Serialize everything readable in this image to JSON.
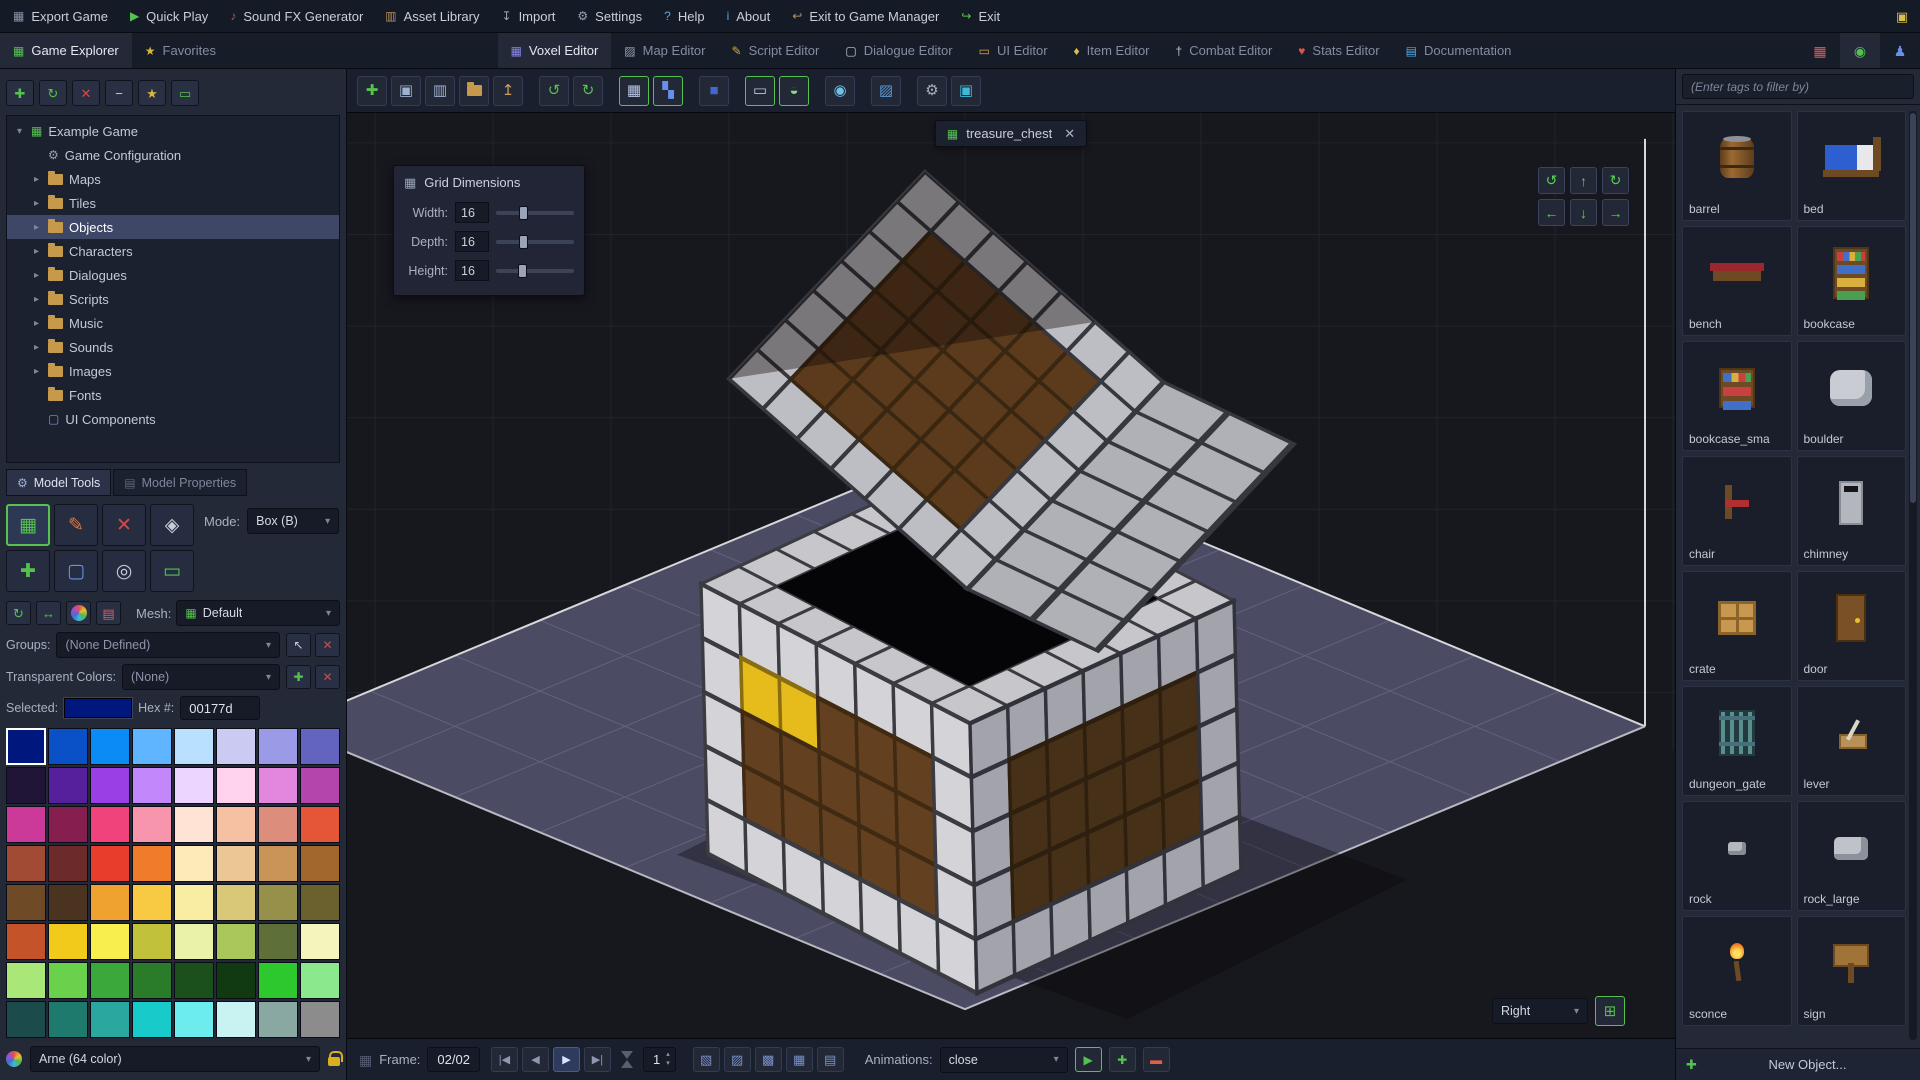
{
  "menu_bar": {
    "items": [
      {
        "name": "export-game",
        "label": "Export Game",
        "glyph": "▦",
        "color": "#8a92a8"
      },
      {
        "name": "quick-play",
        "label": "Quick Play",
        "glyph": "▶",
        "color": "#55c24f"
      },
      {
        "name": "sound-fx-generator",
        "label": "Sound FX Generator",
        "glyph": "♪",
        "color": "#c25050"
      },
      {
        "name": "asset-library",
        "label": "Asset Library",
        "glyph": "▥",
        "color": "#b8905a"
      },
      {
        "name": "import",
        "label": "Import",
        "glyph": "↧",
        "color": "#9aa2b6"
      },
      {
        "name": "settings",
        "label": "Settings",
        "glyph": "⚙",
        "color": "#9aa2b6"
      },
      {
        "name": "help",
        "label": "Help",
        "glyph": "?",
        "color": "#58a8e8"
      },
      {
        "name": "about",
        "label": "About",
        "glyph": "i",
        "color": "#58a8e8"
      },
      {
        "name": "exit-to-game-manager",
        "label": "Exit to Game Manager",
        "glyph": "↩",
        "color": "#b8905a"
      },
      {
        "name": "exit",
        "label": "Exit",
        "glyph": "↪",
        "color": "#55c24f"
      }
    ],
    "corner_icon": {
      "name": "screenshot",
      "glyph": "▣",
      "color": "#d8c050"
    }
  },
  "tab_bar": {
    "left_tabs": [
      {
        "name": "game-explorer",
        "label": "Game Explorer",
        "glyph": "▦",
        "color": "#55c24f",
        "active": true
      },
      {
        "name": "favorites",
        "label": "Favorites",
        "glyph": "★",
        "color": "#d8b838",
        "active": false
      }
    ],
    "editor_tabs": [
      {
        "name": "voxel-editor",
        "label": "Voxel Editor",
        "glyph": "▦",
        "color": "#8585e8",
        "active": true
      },
      {
        "name": "map-editor",
        "label": "Map Editor",
        "glyph": "▨",
        "color": "#9aa2b6",
        "active": false
      },
      {
        "name": "script-editor",
        "label": "Script Editor",
        "glyph": "✎",
        "color": "#d8a838",
        "active": false
      },
      {
        "name": "dialogue-editor",
        "label": "Dialogue Editor",
        "glyph": "▢",
        "color": "#c8cdd9",
        "active": false
      },
      {
        "name": "ui-editor",
        "label": "UI Editor",
        "glyph": "▭",
        "color": "#d8a838",
        "active": false
      },
      {
        "name": "item-editor",
        "label": "Item Editor",
        "glyph": "♦",
        "color": "#d8c050",
        "active": false
      },
      {
        "name": "combat-editor",
        "label": "Combat Editor",
        "glyph": "†",
        "color": "#c0c6d4",
        "active": false
      },
      {
        "name": "stats-editor",
        "label": "Stats Editor",
        "glyph": "♥",
        "color": "#e05050",
        "active": false
      },
      {
        "name": "documentation",
        "label": "Documentation",
        "glyph": "▤",
        "color": "#58a8e8",
        "active": false
      }
    ],
    "panel_tabs": [
      {
        "name": "tiles-panel",
        "glyph": "▦",
        "color": "#d06060",
        "active": false
      },
      {
        "name": "objects-panel",
        "glyph": "◉",
        "color": "#55c24f",
        "active": true
      },
      {
        "name": "characters-panel",
        "glyph": "♟",
        "color": "#6890e8",
        "active": false
      }
    ]
  },
  "explorer": {
    "toolbar": [
      {
        "name": "add-resource",
        "glyph": "✚",
        "color": "#55c24f"
      },
      {
        "name": "refresh-resources",
        "glyph": "↻",
        "color": "#55c24f"
      },
      {
        "name": "delete-resource",
        "glyph": "✕",
        "color": "#d84848"
      },
      {
        "name": "collapse-all",
        "glyph": "−",
        "color": "#c8cdd9"
      },
      {
        "name": "favorite-resource",
        "glyph": "★",
        "color": "#d8b838"
      },
      {
        "name": "toggle-ids",
        "glyph": "▭",
        "color": "#55c24f"
      }
    ],
    "root": {
      "label": "Example Game"
    },
    "items": [
      {
        "label": "Game Configuration",
        "icon": "gear",
        "arrow": false,
        "selected": false
      },
      {
        "label": "Maps",
        "icon": "folder",
        "arrow": true,
        "selected": false
      },
      {
        "label": "Tiles",
        "icon": "folder",
        "arrow": true,
        "selected": false
      },
      {
        "label": "Objects",
        "icon": "folder",
        "arrow": true,
        "selected": true
      },
      {
        "label": "Characters",
        "icon": "folder",
        "arrow": true,
        "selected": false
      },
      {
        "label": "Dialogues",
        "icon": "folder",
        "arrow": true,
        "selected": false
      },
      {
        "label": "Scripts",
        "icon": "folder",
        "arrow": true,
        "selected": false
      },
      {
        "label": "Music",
        "icon": "folder",
        "arrow": true,
        "selected": false
      },
      {
        "label": "Sounds",
        "icon": "folder",
        "arrow": true,
        "selected": false
      },
      {
        "label": "Images",
        "icon": "folder",
        "arrow": true,
        "selected": false
      },
      {
        "label": "Fonts",
        "icon": "folder",
        "arrow": false,
        "selected": false
      },
      {
        "label": "UI Components",
        "icon": "component",
        "arrow": false,
        "selected": false
      }
    ]
  },
  "model_tools": {
    "tabs": [
      {
        "label": "Model Tools",
        "glyph": "⚙",
        "active": true
      },
      {
        "label": "Model Properties",
        "glyph": "▤",
        "active": false
      }
    ],
    "tools": [
      {
        "name": "attach-tool",
        "glyph": "▦",
        "color": "#55c24f",
        "selected": true
      },
      {
        "name": "paint-tool",
        "glyph": "✎",
        "color": "#d87848",
        "selected": false
      },
      {
        "name": "erase-tool",
        "glyph": "✕",
        "color": "#d84848",
        "selected": false
      },
      {
        "name": "fill-tool",
        "glyph": "◈",
        "color": "#c8cdd9",
        "selected": false
      },
      {
        "name": "resize-tool",
        "glyph": "✚",
        "color": "#55c24f",
        "selected": false
      },
      {
        "name": "select-tool",
        "glyph": "▢",
        "color": "#6890e8",
        "selected": false
      },
      {
        "name": "picker-tool",
        "glyph": "◎",
        "color": "#c8cdd9",
        "selected": false
      },
      {
        "name": "attach-point-tool",
        "glyph": "▭",
        "color": "#55c24f",
        "selected": false
      }
    ],
    "mode_label": "Mode:",
    "mode_value": "Box (B)",
    "small_tools": [
      {
        "name": "rotate-model",
        "glyph": "↻",
        "color": "#55c24f",
        "pal": false
      },
      {
        "name": "center-model",
        "glyph": "↔",
        "color": "#55c24f",
        "pal": false
      },
      {
        "name": "swap-palette",
        "glyph": "",
        "color": "",
        "pal": true
      },
      {
        "name": "frame-card",
        "glyph": "▤",
        "color": "#d86060",
        "pal": false
      }
    ],
    "mesh_label": "Mesh:",
    "mesh_value": "Default",
    "groups_label": "Groups:",
    "groups_value": "(None Defined)",
    "groups_buttons": [
      {
        "name": "pick-group",
        "glyph": "↖",
        "color": "#c8cdd9"
      },
      {
        "name": "delete-group",
        "glyph": "✕",
        "color": "#d84848"
      }
    ],
    "transparent_label": "Transparent Colors:",
    "transparent_value": "(None)",
    "transparent_buttons": [
      {
        "name": "add-transparent-color",
        "glyph": "✚",
        "color": "#55c24f"
      },
      {
        "name": "delete-transparent-color",
        "glyph": "✕",
        "color": "#d84848"
      }
    ],
    "selected_label": "Selected:",
    "hex_label": "Hex #:",
    "hex_value": "00177d",
    "selected_color": "#00177d",
    "palette_name": "Arne (64 color)",
    "palette": [
      "#00177d",
      "#0a51c8",
      "#0b8bf5",
      "#5fb5ff",
      "#b9e1ff",
      "#cacaf2",
      "#9a9ae6",
      "#6363c0",
      "#201536",
      "#56209c",
      "#9a3fe6",
      "#c287fa",
      "#ecd5ff",
      "#ffd3ee",
      "#e287dd",
      "#b445ad",
      "#cc3a99",
      "#861f4f",
      "#f0437c",
      "#f795ad",
      "#ffe3d5",
      "#f6c1a3",
      "#dd8d7b",
      "#e55537",
      "#a14b35",
      "#6d2a2a",
      "#e83c2d",
      "#f07c2b",
      "#fceab8",
      "#eac795",
      "#c99457",
      "#a2672c",
      "#6e4a27",
      "#4a3420",
      "#f0a231",
      "#f8c943",
      "#f9eda3",
      "#d9c877",
      "#97904a",
      "#6a612f",
      "#c4532a",
      "#f2ca1c",
      "#f8ef4e",
      "#c2c23a",
      "#e9f2a8",
      "#aac75b",
      "#5f6f3a",
      "#f4f4bc",
      "#a9e878",
      "#69d14b",
      "#3aa83a",
      "#2a7c2a",
      "#1b4f1b",
      "#123a12",
      "#2dc82d",
      "#8ce88c",
      "#1b4b4b",
      "#1d7a6c",
      "#2aa8a0",
      "#19caca",
      "#6cecec",
      "#c9f2f2",
      "#8aa8a2",
      "#8c8c8c"
    ]
  },
  "viewport": {
    "toolbar": [
      {
        "name": "new-model",
        "glyph": "✚",
        "color": "#55c24f",
        "active": false,
        "gap": false
      },
      {
        "name": "save-model",
        "glyph": "▣",
        "color": "#9fb0d0",
        "active": false,
        "gap": false
      },
      {
        "name": "save-model-as",
        "glyph": "▥",
        "color": "#9fb0d0",
        "active": false,
        "gap": false
      },
      {
        "name": "open-model-folder",
        "glyph": "folder",
        "color": "#c79a4b",
        "active": false,
        "gap": false
      },
      {
        "name": "export-model",
        "glyph": "↥",
        "color": "#c8a060",
        "active": false,
        "gap": false
      },
      {
        "name": "undo",
        "glyph": "↺",
        "color": "#55c24f",
        "active": false,
        "gap": true
      },
      {
        "name": "redo",
        "glyph": "↻",
        "color": "#55c24f",
        "active": false,
        "gap": false
      },
      {
        "name": "toggle-grid",
        "glyph": "▦",
        "color": "#b8c8e8",
        "active": true,
        "gap": true
      },
      {
        "name": "toggle-blocks",
        "glyph": "▚",
        "color": "#6890e8",
        "active": true,
        "gap": false
      },
      {
        "name": "selection-box",
        "glyph": "■",
        "color": "#4068d0",
        "active": false,
        "gap": true
      },
      {
        "name": "camera-view",
        "glyph": "▭",
        "color": "#b8c8e8",
        "active": true,
        "gap": true
      },
      {
        "name": "toggle-lighting",
        "glyph": "◒",
        "color": "#88d888",
        "active": true,
        "gap": false
      },
      {
        "name": "world-sphere",
        "glyph": "◉",
        "color": "#70c0e8",
        "active": false,
        "gap": true
      },
      {
        "name": "screenshot-model",
        "glyph": "▨",
        "color": "#5898d8",
        "active": false,
        "gap": true
      },
      {
        "name": "model-settings",
        "glyph": "⚙",
        "color": "#a8b0c0",
        "active": false,
        "gap": true
      },
      {
        "name": "model-info",
        "glyph": "▣",
        "color": "#40b8d8",
        "active": false,
        "gap": false
      }
    ],
    "tab": {
      "label": "treasure_chest"
    },
    "grid_panel": {
      "title": "Grid Dimensions",
      "rows": [
        {
          "label": "Width:",
          "value": "16",
          "pos": 30
        },
        {
          "label": "Depth:",
          "value": "16",
          "pos": 30
        },
        {
          "label": "Height:",
          "value": "16",
          "pos": 28
        }
      ]
    },
    "nav_arrows": [
      {
        "name": "orbit-left",
        "glyph": "↺"
      },
      {
        "name": "move-up",
        "glyph": "↑"
      },
      {
        "name": "orbit-right",
        "glyph": "↻"
      },
      {
        "name": "move-left",
        "glyph": "←"
      },
      {
        "name": "move-down",
        "glyph": "↓"
      },
      {
        "name": "move-right",
        "glyph": "→"
      }
    ],
    "view_label": "Right",
    "frame_bar": {
      "frame_label": "Frame:",
      "frame_value": "02/02",
      "playback": [
        {
          "name": "first-frame",
          "glyph": "|◀",
          "active": false
        },
        {
          "name": "prev-frame",
          "glyph": "◀",
          "active": false
        },
        {
          "name": "play-frames",
          "glyph": "▶",
          "active": true
        },
        {
          "name": "last-frame",
          "glyph": "▶|",
          "active": false
        }
      ],
      "speed_value": "1",
      "mid_icons": [
        {
          "name": "copy-frame",
          "glyph": "▧",
          "color": "#7a90c8"
        },
        {
          "name": "paste-frame",
          "glyph": "▨",
          "color": "#7a90c8"
        },
        {
          "name": "add-frame",
          "glyph": "▩",
          "color": "#7a90c8"
        },
        {
          "name": "duplicate-frame",
          "glyph": "▦",
          "color": "#7a90c8"
        },
        {
          "name": "delete-frame",
          "glyph": "▤",
          "color": "#7a90c8"
        }
      ],
      "animations_label": "Animations:",
      "animation_value": "close",
      "anim_buttons": [
        {
          "name": "play-animation",
          "glyph": "▶",
          "color": "#55c24f"
        },
        {
          "name": "add-animation",
          "glyph": "✚",
          "color": "#55c24f"
        },
        {
          "name": "remove-animation",
          "glyph": "▬",
          "color": "#e06040"
        }
      ]
    }
  },
  "objects_panel": {
    "filter_placeholder": "(Enter tags to filter by)",
    "new_button_label": "New Object...",
    "items": [
      {
        "label": "barrel",
        "thumb": "barrel"
      },
      {
        "label": "bed",
        "thumb": "bed"
      },
      {
        "label": "bench",
        "thumb": "bench"
      },
      {
        "label": "bookcase",
        "thumb": "bookcase"
      },
      {
        "label": "bookcase_sma",
        "thumb": "bookcase2"
      },
      {
        "label": "boulder",
        "thumb": "boulder"
      },
      {
        "label": "chair",
        "thumb": "chair"
      },
      {
        "label": "chimney",
        "thumb": "chimney"
      },
      {
        "label": "crate",
        "thumb": "crate"
      },
      {
        "label": "door",
        "thumb": "door"
      },
      {
        "label": "dungeon_gate",
        "thumb": "gate"
      },
      {
        "label": "lever",
        "thumb": "lever"
      },
      {
        "label": "rock",
        "thumb": "rock"
      },
      {
        "label": "rock_large",
        "thumb": "rock2"
      },
      {
        "label": "sconce",
        "thumb": "sconce"
      },
      {
        "label": "sign",
        "thumb": "sign"
      }
    ]
  },
  "colors": {
    "accent_green": "#55c24f",
    "selection_blue": "#3e4765",
    "danger_red": "#d84848",
    "panel_background": "#242938",
    "viewport_floor": "#4b4b63",
    "chest_gray": "#c6c6cb",
    "chest_wood": "#63401f",
    "chest_gold": "#e6bb1c"
  }
}
